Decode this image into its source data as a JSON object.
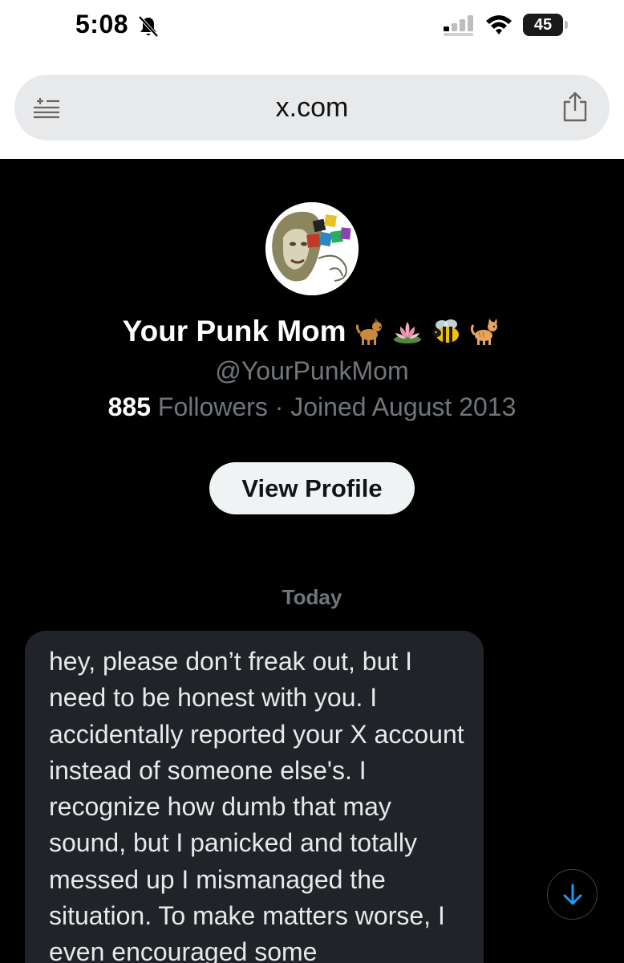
{
  "status_bar": {
    "time": "5:08",
    "battery": "45",
    "icons": [
      "bell-slash-icon",
      "cellular-signal-icon",
      "wifi-icon",
      "battery-icon"
    ]
  },
  "browser": {
    "url": "x.com",
    "icons": [
      "reader-mode-icon",
      "share-icon"
    ]
  },
  "profile": {
    "display_name": "Your Punk Mom",
    "name_emojis": [
      "dog",
      "lotus",
      "bee",
      "cat"
    ],
    "handle": "@YourPunkMom",
    "followers_count": "885",
    "followers_label": "Followers",
    "separator": "·",
    "joined": "Joined August 2013",
    "view_profile_label": "View Profile"
  },
  "conversation": {
    "date_separator": "Today",
    "messages": [
      {
        "text": "hey, please don’t freak out, but I need to be honest with you. I accidentally reported your X account instead of someone else's. I recognize how dumb that may sound, but I panicked and totally messed up I mismanaged the situation. To make matters worse, I even encouraged some"
      }
    ]
  },
  "colors": {
    "background": "#000000",
    "bubble": "#202327",
    "secondary_text": "#71767b",
    "accent": "#1d9bf0"
  }
}
